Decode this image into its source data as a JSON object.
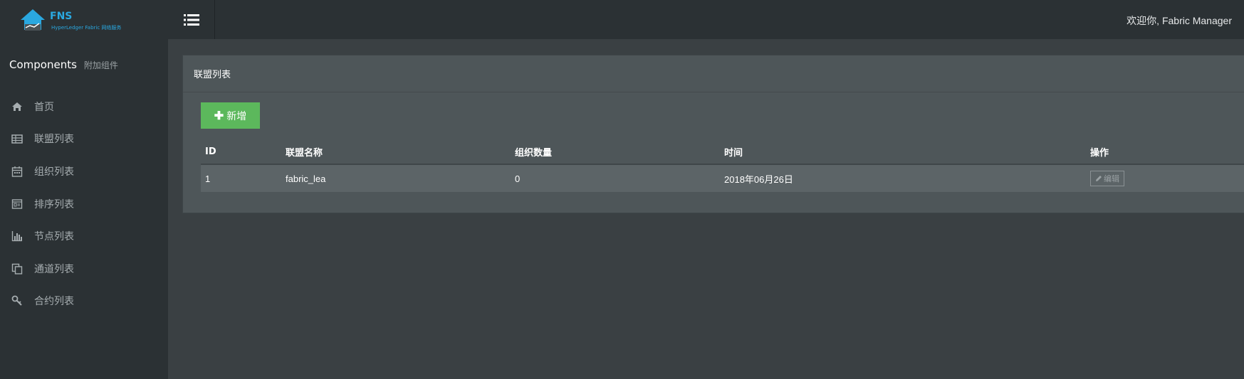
{
  "logo": {
    "title": "FNS",
    "subtitle": "HyperLedger Fabric 网络服务",
    "color": "#2aa8e0"
  },
  "sidebar": {
    "section_title": "Components",
    "section_addon": "附加组件",
    "items": [
      {
        "label": "首页",
        "icon": "home-icon"
      },
      {
        "label": "联盟列表",
        "icon": "table-icon"
      },
      {
        "label": "组织列表",
        "icon": "calendar-icon"
      },
      {
        "label": "排序列表",
        "icon": "list-box-icon"
      },
      {
        "label": "节点列表",
        "icon": "bar-chart-icon"
      },
      {
        "label": "通道列表",
        "icon": "copy-icon"
      },
      {
        "label": "合约列表",
        "icon": "key-icon"
      }
    ]
  },
  "topbar": {
    "welcome": "欢迎你, Fabric Manager"
  },
  "panel": {
    "title": "联盟列表",
    "add_label": "新增",
    "add_color": "#5cb85c",
    "columns": [
      "ID",
      "联盟名称",
      "组织数量",
      "时间",
      "操作"
    ],
    "rows": [
      {
        "id": "1",
        "name": "fabric_lea",
        "org_count": "0",
        "time": "2018年06月26日",
        "action": "编辑"
      }
    ]
  }
}
